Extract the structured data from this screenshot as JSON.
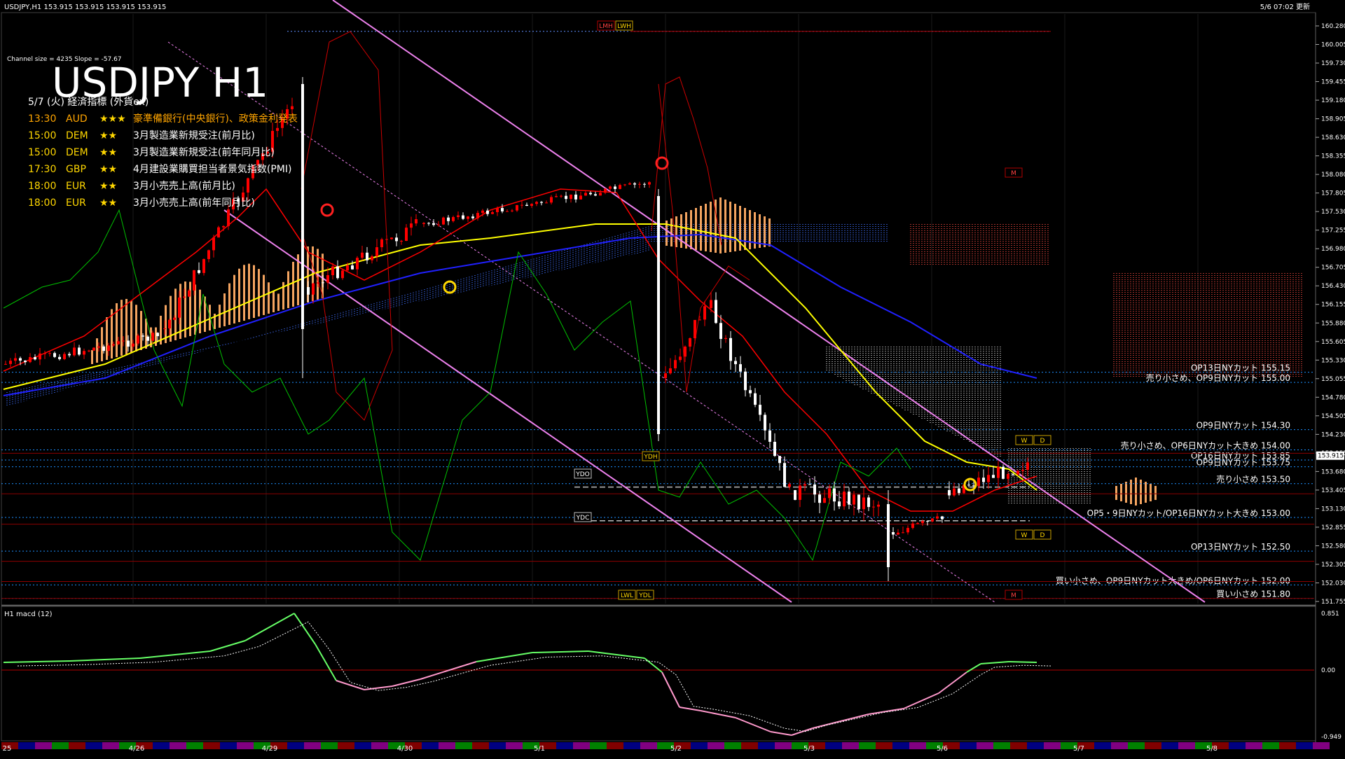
{
  "header": {
    "symbol_info": "USDJPY,H1  153.915 153.915 153.915 153.915",
    "update_time": "5/6 07:02 更新",
    "channel_info": "Channel size = 4235 Slope = -57.67",
    "big_title": "USDJPY H1"
  },
  "calendar": {
    "heading": "5/7 (火) 経済指標 (外貨ex)",
    "events": [
      {
        "time": "13:30",
        "currency": "AUD",
        "stars": "★★★",
        "name": "豪準備銀行(中央銀行)、政策金利発表"
      },
      {
        "time": "15:00",
        "currency": "DEM",
        "stars": "★★",
        "name": "3月製造業新規受注(前月比)"
      },
      {
        "time": "15:00",
        "currency": "DEM",
        "stars": "★★",
        "name": "3月製造業新規受注(前年同月比)"
      },
      {
        "time": "17:30",
        "currency": "GBP",
        "stars": "★★",
        "name": "4月建設業購買担当者景気指数(PMI)"
      },
      {
        "time": "18:00",
        "currency": "EUR",
        "stars": "★★",
        "name": "3月小売売上高(前月比)"
      },
      {
        "time": "18:00",
        "currency": "EUR",
        "stars": "★★",
        "name": "3月小売売上高(前年同月比)"
      }
    ]
  },
  "price_axis": {
    "labels": [
      "160.280",
      "160.005",
      "159.730",
      "159.455",
      "159.180",
      "158.905",
      "158.630",
      "158.355",
      "158.080",
      "157.805",
      "157.530",
      "157.255",
      "156.980",
      "156.705",
      "156.430",
      "156.155",
      "155.880",
      "155.605",
      "155.330",
      "155.055",
      "154.780",
      "154.505",
      "154.230",
      "153.955",
      "153.680",
      "153.405",
      "153.130",
      "152.855",
      "152.580",
      "152.305",
      "152.030",
      "151.755"
    ],
    "current_price": "153.915"
  },
  "levels": [
    {
      "price": 155.15,
      "label": "OP13日NYカット 155.15"
    },
    {
      "price": 155.0,
      "label": "売り小さめ、OP9日NYカット 155.00"
    },
    {
      "price": 154.3,
      "label": "OP9日NYカット 154.30"
    },
    {
      "price": 154.0,
      "label": "売り小さめ、OP6日NYカット大きめ 154.00"
    },
    {
      "price": 153.85,
      "label": "OP16日NYカット 153.85"
    },
    {
      "price": 153.75,
      "label": "OP9日NYカット 153.75"
    },
    {
      "price": 153.5,
      "label": "売り小さめ 153.50"
    },
    {
      "price": 153.0,
      "label": "OP5・9日NYカット/OP16日NYカット大きめ 153.00"
    },
    {
      "price": 152.5,
      "label": "OP13日NYカット 152.50"
    },
    {
      "price": 152.0,
      "label": "買い小さめ、OP9日NYカット大きめ/OP6日NYカット 152.00"
    },
    {
      "price": 151.8,
      "label": "買い小さめ 151.80"
    }
  ],
  "markers": {
    "lmh": "LMH",
    "lwh": "LWH",
    "lwl": "LWL",
    "ydl": "YDL",
    "ydh": "YDH",
    "ydo": "YDO",
    "ydc": "YDC",
    "m_top": "M",
    "m_bottom": "M",
    "w_top": "W",
    "d_top": "D",
    "w_bottom": "W",
    "d_bottom": "D"
  },
  "macd_panel": {
    "title": "H1 macd (12)",
    "axis_labels": [
      "0.851",
      "0.00",
      "-0.949"
    ]
  },
  "date_axis": {
    "dates": [
      "25",
      "4/26",
      "4/29",
      "4/30",
      "5/1",
      "5/2",
      "5/3",
      "5/6",
      "5/7",
      "5/8"
    ]
  },
  "colors": {
    "background": "#000000",
    "grid": "#1a1a1a",
    "level_line": "#1e90ff",
    "level_line_red": "#b00000",
    "bull_candle": "#ffffff",
    "bear_candle": "#ff0000",
    "ma_yellow": "#ffff00",
    "ma_blue": "#2020ff",
    "ma_red": "#ff0000",
    "channel": "#ee82ee",
    "chikou": "#00c000",
    "macd_line": "#66ff66",
    "macd_neg": "#ff99cc",
    "calendar_aud": "#ffa500",
    "calendar_other": "#ffffff"
  }
}
